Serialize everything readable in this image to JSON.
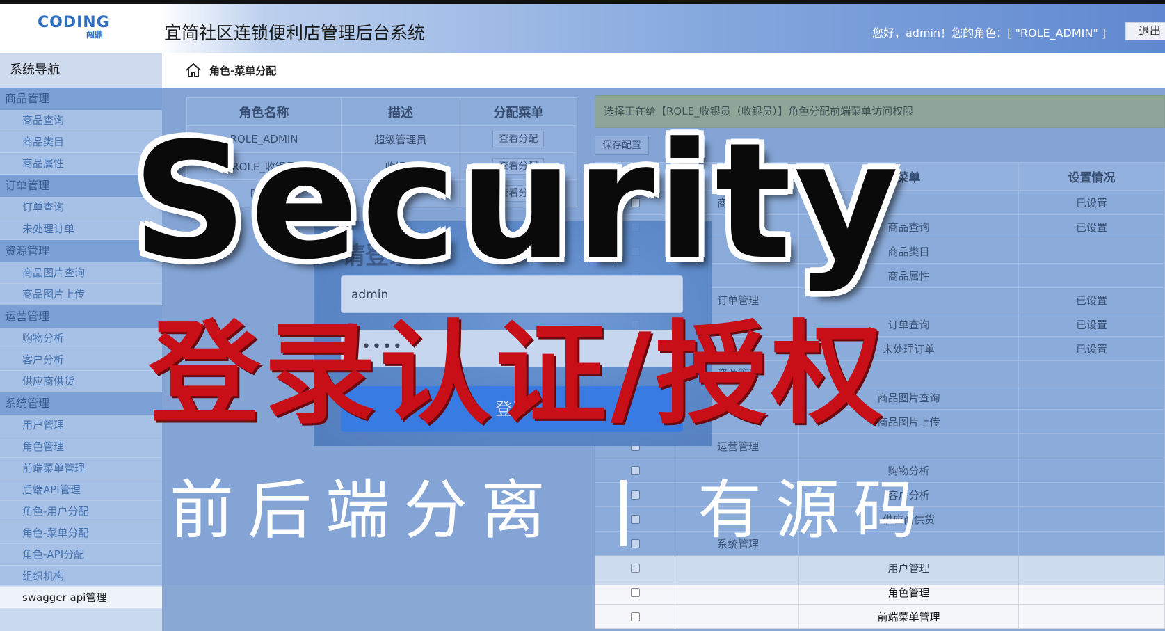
{
  "header": {
    "logo_main": "CODING",
    "logo_sub": "闯鼎",
    "app_title": "宜简社区连锁便利店管理后台系统",
    "greeting": "您好，admin！您的角色：[ \"ROLE_ADMIN\" ]",
    "logout_label": "退出"
  },
  "sidebar": {
    "title": "系统导航",
    "groups": [
      {
        "label": "商品管理",
        "items": [
          "商品查询",
          "商品类目",
          "商品属性"
        ]
      },
      {
        "label": "订单管理",
        "items": [
          "订单查询",
          "未处理订单"
        ]
      },
      {
        "label": "资源管理",
        "items": [
          "商品图片查询",
          "商品图片上传"
        ]
      },
      {
        "label": "运营管理",
        "items": [
          "购物分析",
          "客户分析",
          "供应商供货"
        ]
      },
      {
        "label": "系统管理",
        "items": [
          "用户管理",
          "角色管理",
          "前端菜单管理",
          "后端API管理",
          "角色-用户分配",
          "角色-菜单分配",
          "角色-API分配",
          "组织机构",
          "swagger api管理"
        ]
      }
    ]
  },
  "breadcrumb": {
    "label": "角色-菜单分配"
  },
  "role_table": {
    "headers": [
      "角色名称",
      "描述",
      "分配菜单"
    ],
    "rows": [
      {
        "name": "ROLE_ADMIN",
        "desc": "超级管理员",
        "action": "查看分配"
      },
      {
        "name": "ROLE_收银员",
        "desc": "收银员",
        "action": "查看分配"
      },
      {
        "name": "ROLE",
        "desc": "",
        "action": "查看分配"
      }
    ]
  },
  "notice": "选择正在给【ROLE_收银员（收银员）】角色分配前端菜单访问权限",
  "save_label": "保存配置",
  "menu_table": {
    "headers": [
      "",
      "一级",
      "菜单",
      "设置情况"
    ],
    "rows": [
      {
        "parent": "商品管理",
        "child": "",
        "status": "已设置"
      },
      {
        "parent": "",
        "child": "商品查询",
        "status": "已设置"
      },
      {
        "parent": "",
        "child": "商品类目",
        "status": ""
      },
      {
        "parent": "",
        "child": "商品属性",
        "status": ""
      },
      {
        "parent": "订单管理",
        "child": "",
        "status": "已设置"
      },
      {
        "parent": "",
        "child": "订单查询",
        "status": "已设置"
      },
      {
        "parent": "",
        "child": "未处理订单",
        "status": "已设置"
      },
      {
        "parent": "资源管理",
        "child": "",
        "status": ""
      },
      {
        "parent": "",
        "child": "商品图片查询",
        "status": ""
      },
      {
        "parent": "",
        "child": "商品图片上传",
        "status": ""
      },
      {
        "parent": "运营管理",
        "child": "",
        "status": ""
      },
      {
        "parent": "",
        "child": "购物分析",
        "status": ""
      },
      {
        "parent": "",
        "child": "客户分析",
        "status": ""
      },
      {
        "parent": "",
        "child": "供应商供货",
        "status": ""
      },
      {
        "parent": "系统管理",
        "child": "",
        "status": ""
      },
      {
        "parent": "",
        "child": "用户管理",
        "status": ""
      },
      {
        "parent": "",
        "child": "角色管理",
        "status": ""
      },
      {
        "parent": "",
        "child": "前端菜单管理",
        "status": ""
      }
    ]
  },
  "login": {
    "heading": "请登录",
    "username": "admin",
    "password_mask": "•••••",
    "submit_label": "登录"
  },
  "overlay": {
    "title": "Security",
    "subtitle": "登录认证/授权",
    "tagline_left": "前后端分离",
    "tagline_right": "有源码"
  }
}
